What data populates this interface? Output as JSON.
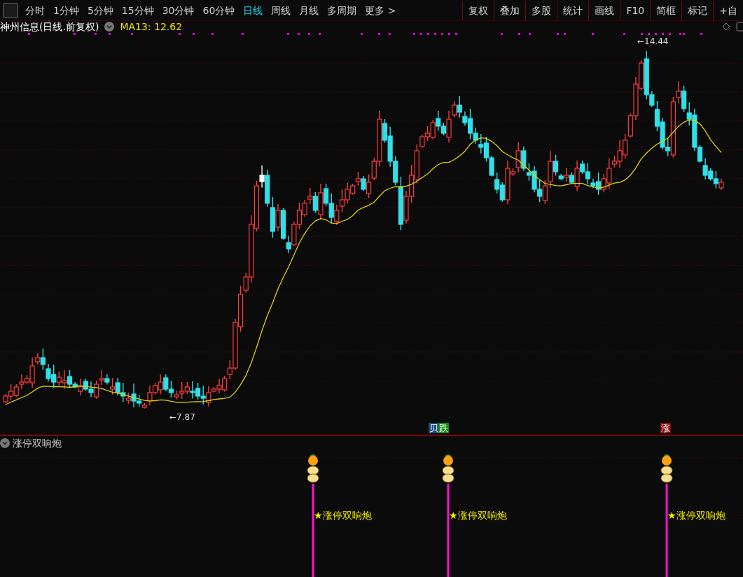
{
  "toolbar": {
    "periods": [
      {
        "label": "分时",
        "selected": false
      },
      {
        "label": "1分钟",
        "selected": false
      },
      {
        "label": "5分钟",
        "selected": false
      },
      {
        "label": "15分钟",
        "selected": false
      },
      {
        "label": "30分钟",
        "selected": false
      },
      {
        "label": "60分钟",
        "selected": false
      },
      {
        "label": "日线",
        "selected": true
      },
      {
        "label": "周线",
        "selected": false
      },
      {
        "label": "月线",
        "selected": false
      },
      {
        "label": "多周期",
        "selected": false
      },
      {
        "label": "更多 >",
        "selected": false
      }
    ],
    "tools": [
      "复权",
      "叠加",
      "多股",
      "统计",
      "画线",
      "F10",
      "简框",
      "标记",
      "+自"
    ]
  },
  "chart": {
    "title": "神州信息(日线.前复权)",
    "ma_label": "MA13: 12.62",
    "high_label": "←14.44",
    "low_label": "←7.87",
    "markers": [
      {
        "text": "贝",
        "color": "#154a80"
      },
      {
        "text": "跌",
        "color": "#128a12"
      },
      {
        "text": "涨",
        "color": "#8a0c0c"
      }
    ]
  },
  "indicator": {
    "title": "涨停双响炮",
    "signals": [
      {
        "label": "★涨停双响炮"
      },
      {
        "label": "★涨停双响炮"
      },
      {
        "label": "★涨停双响炮"
      }
    ]
  }
}
